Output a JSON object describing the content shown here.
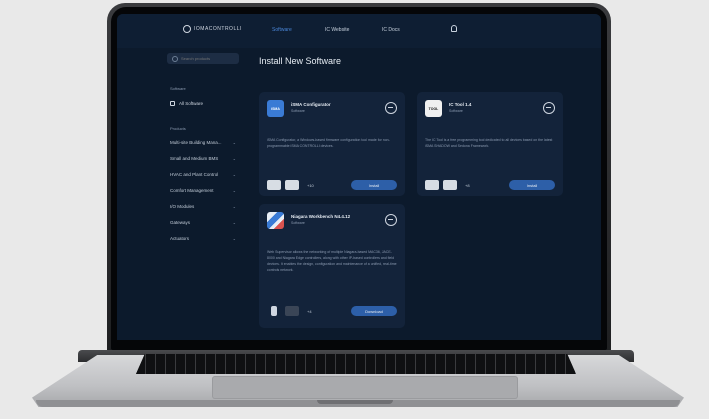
{
  "header": {
    "brand": "IOMACONTROLLI",
    "nav": [
      "Software",
      "IC Website",
      "IC Docs"
    ],
    "active_nav": "Software"
  },
  "sidebar": {
    "search_placeholder": "Search products",
    "software_label": "Software",
    "all_software": "All Software",
    "products_label": "Products",
    "products": [
      "Multi-site Building Mana...",
      "Small and Medium BMS",
      "HVAC and Plant Control",
      "Comfort Management",
      "I/O Modules",
      "Gateways",
      "Actuators"
    ]
  },
  "main": {
    "title": "Install New Software",
    "cards": [
      {
        "name": "iSMA Configurator",
        "type": "Software",
        "logo_text": "iSMA",
        "description": "iSMA Configurator, a Windows-based firmware configuration tool made for non-programmable iSMA CONTROLLI devices.",
        "more": "+10",
        "action": "Install"
      },
      {
        "name": "IC Tool 1.4",
        "type": "Software",
        "logo_text": "TOOL",
        "description": "The IC Tool is a free programming tool dedicated to all devices based on the latest iSMA SHADOW and Sedona Framework.",
        "more": "+8",
        "action": "Install"
      },
      {
        "name": "Niagara Workbench N4.4.12",
        "type": "Software",
        "logo_text": "",
        "description": "Web Supervisor allows the networking of multiple Niagara-based MAC36, JACE-8000 and Niagara Edge controllers, along with other IP-based controllers and field devices. It enables the design, configuration and maintenance of a unified, real-time controls network.",
        "more": "+4",
        "action": "Download"
      }
    ]
  },
  "colors": {
    "screen_bg": "#0c1a2c",
    "card_bg": "#13233a",
    "accent": "#2d5fa8",
    "active_nav": "#4a86d8"
  }
}
